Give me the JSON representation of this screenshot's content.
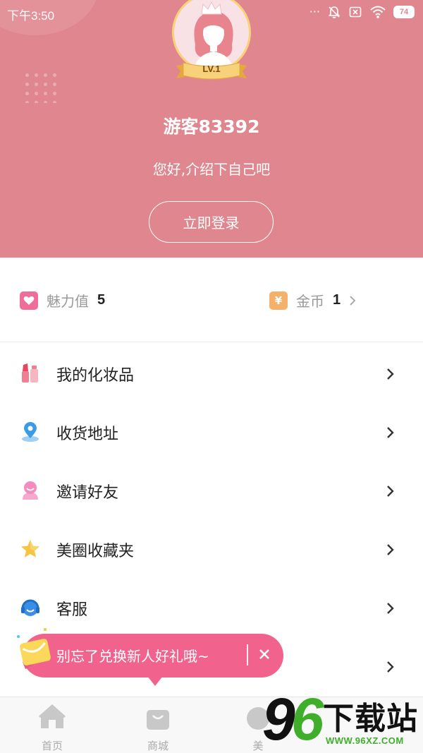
{
  "status_bar": {
    "time": "下午3:50",
    "icons": [
      "more-dots-icon",
      "mute-icon",
      "sim-off-icon",
      "wifi-icon",
      "battery-icon"
    ],
    "battery": "74"
  },
  "profile": {
    "level": "LV.1",
    "username": "游客83392",
    "tagline": "您好,介绍下自己吧",
    "login_label": "立即登录"
  },
  "stats": {
    "charm": {
      "label": "魅力值",
      "value": "5",
      "icon": "heart-icon"
    },
    "coins": {
      "label": "金币",
      "value": "1",
      "icon": "yen-icon",
      "icon_glyph": "¥"
    }
  },
  "menu": {
    "items": [
      {
        "label": "我的化妆品",
        "icon": "cosmetics-icon"
      },
      {
        "label": "收货地址",
        "icon": "location-pin-icon"
      },
      {
        "label": "邀请好友",
        "icon": "invite-friend-icon"
      },
      {
        "label": "美圈收藏夹",
        "icon": "star-icon"
      },
      {
        "label": "客服",
        "icon": "headset-icon"
      },
      {
        "label": "",
        "icon": ""
      }
    ]
  },
  "tooltip": {
    "text": "别忘了兑换新人好礼哦~"
  },
  "bottom_nav": {
    "tabs": [
      {
        "label": "首页",
        "icon": "home-icon"
      },
      {
        "label": "商城",
        "icon": "shopping-bag-icon"
      },
      {
        "label": "美",
        "icon": "beauty-icon"
      }
    ]
  },
  "watermark": {
    "logo_digits_a": "9",
    "logo_digits_b": "6",
    "site_name": "下载站",
    "url": "WWW.96XZ.COM"
  },
  "colors": {
    "header_bg": "#e0868f",
    "tooltip_bg": "#f1638c",
    "charm_icon": "#ef6e99",
    "coin_icon": "#f4b16a",
    "watermark_green": "#3fae2a"
  }
}
